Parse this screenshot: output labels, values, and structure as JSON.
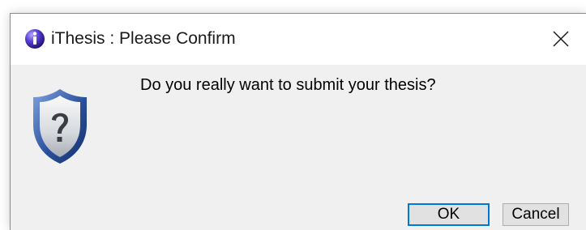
{
  "dialog": {
    "title": "iThesis : Please Confirm",
    "message": "Do you really want to submit your thesis?",
    "ok_label": "OK",
    "cancel_label": "Cancel",
    "app_icon": "ithesis-app-icon",
    "dialog_icon": "question-shield-icon",
    "close_icon": "close-icon"
  },
  "colors": {
    "focus_border": "#0078d7",
    "content_bg": "#f0f0f0",
    "shield_blue": "#2a4f9c"
  }
}
